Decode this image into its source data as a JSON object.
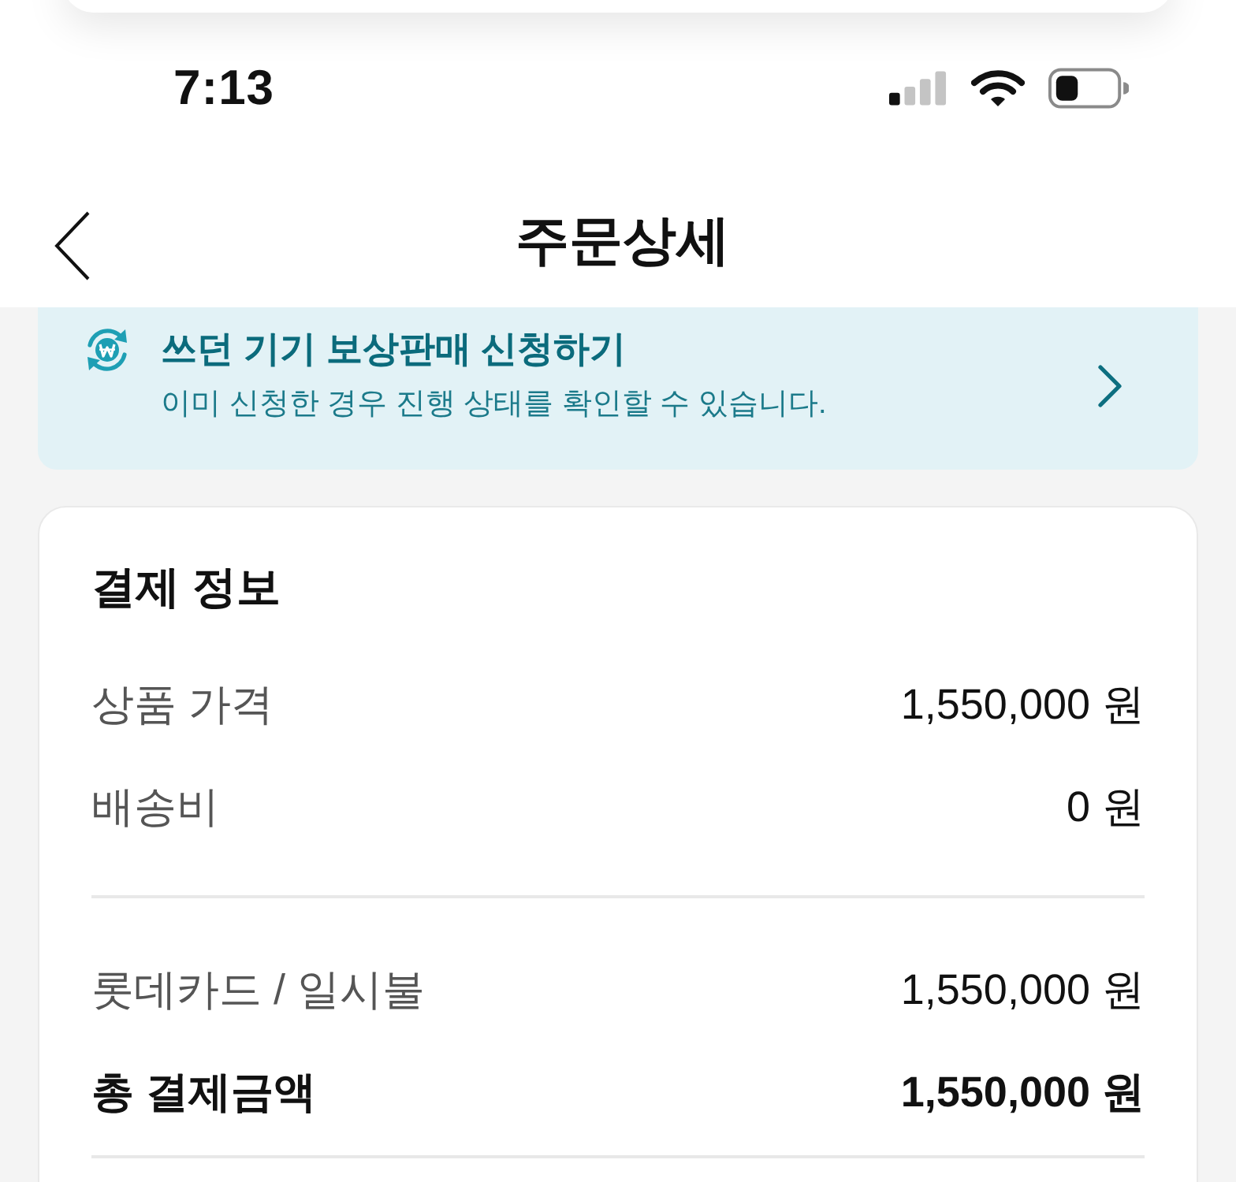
{
  "status_bar": {
    "time": "7:13"
  },
  "nav_bar": {
    "title": "주문상세"
  },
  "trade_in_banner": {
    "title": "쓰던 기기 보상판매 신청하기",
    "subtitle": "이미 신청한 경우 진행 상태를 확인할 수 있습니다."
  },
  "payment_info": {
    "title": "결제 정보",
    "sections": [
      {
        "rows": [
          {
            "kind": "item",
            "label": "상품 가격",
            "value": "1,550,000 원"
          },
          {
            "kind": "item",
            "label": "배송비",
            "value": "0 원"
          }
        ]
      },
      {
        "rows": [
          {
            "kind": "item",
            "label": "롯데카드 / 일시불",
            "value": "1,550,000 원"
          },
          {
            "kind": "total",
            "label": "총 결제금액",
            "value": "1,550,000 원"
          }
        ]
      }
    ]
  }
}
